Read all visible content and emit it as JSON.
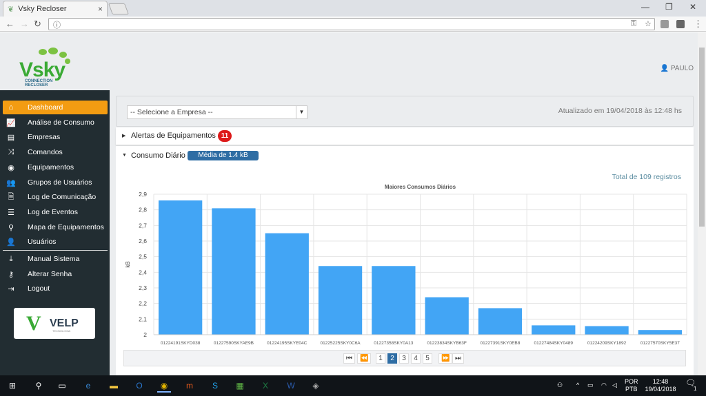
{
  "browser": {
    "tab_title": "Vsky Recloser",
    "tab_close": "×",
    "win_min": "—",
    "win_max": "❐",
    "win_close": "✕"
  },
  "header": {
    "logo_text": "Vsky",
    "logo_sub1": "CONNECTION",
    "logo_sub2": "RECLOSER",
    "user": "PAULO"
  },
  "sidebar": {
    "items": [
      {
        "label": "Dashboard",
        "icon": "home-icon"
      },
      {
        "label": "Análise de Consumo",
        "icon": "line-chart-icon"
      },
      {
        "label": "Empresas",
        "icon": "id-card-icon"
      },
      {
        "label": "Comandos",
        "icon": "shuffle-icon"
      },
      {
        "label": "Equipamentos",
        "icon": "podcast-icon"
      },
      {
        "label": "Grupos de Usuários",
        "icon": "users-icon"
      },
      {
        "label": "Log de Comunicação",
        "icon": "file-icon"
      },
      {
        "label": "Log de Eventos",
        "icon": "list-icon"
      },
      {
        "label": "Mapa de Equipamentos",
        "icon": "map-marker-icon"
      },
      {
        "label": "Usuários",
        "icon": "user-icon"
      },
      {
        "label": "Manual Sistema",
        "icon": "download-icon"
      },
      {
        "label": "Alterar Senha",
        "icon": "key-icon"
      },
      {
        "label": "Logout",
        "icon": "sign-out-icon"
      }
    ],
    "velp": {
      "mark": "V",
      "text": "VELP",
      "sub": "TECNOLOGIA"
    }
  },
  "filter": {
    "select_value": "-- Selecione a Empresa --",
    "updated": "Atualizado em 19/04/2018 às 12:48 hs"
  },
  "alerts": {
    "label": "Alertas de Equipamentos",
    "count": "11"
  },
  "consumo": {
    "label": "Consumo Diário",
    "media": "Média de 1.4 kB",
    "total": "Total de 109 registros"
  },
  "chart_data": {
    "type": "bar",
    "title": "Maiores Consumos Diários",
    "xlabel": "",
    "ylabel": "kB",
    "ylim": [
      2,
      2.9
    ],
    "yticks": [
      "2",
      "2,1",
      "2,2",
      "2,3",
      "2,4",
      "2,5",
      "2,6",
      "2,7",
      "2,8",
      "2,9"
    ],
    "categories": [
      "01224191SKYD038",
      "01227590SKYAE9B",
      "01224195SKYE04C",
      "01225225SKY0C6A",
      "01227358SKY0A13",
      "01223834SKYB63F",
      "01227391SKY0EB8",
      "01227484SKY0489",
      "01224209SKY1892",
      "01227570SKY5E37"
    ],
    "values": [
      2.86,
      2.81,
      2.65,
      2.44,
      2.44,
      2.24,
      2.17,
      2.06,
      2.055,
      2.03
    ],
    "color": "#42a5f5",
    "grid": true
  },
  "pager": {
    "first": "⏮",
    "prev": "⏪",
    "pages": [
      "1",
      "2",
      "3",
      "4",
      "5"
    ],
    "current": "2",
    "next": "⏩",
    "last": "⏭"
  },
  "taskbar": {
    "lang1": "POR",
    "lang2": "PTB",
    "time": "12:48",
    "date": "19/04/2018",
    "notif": "1"
  }
}
